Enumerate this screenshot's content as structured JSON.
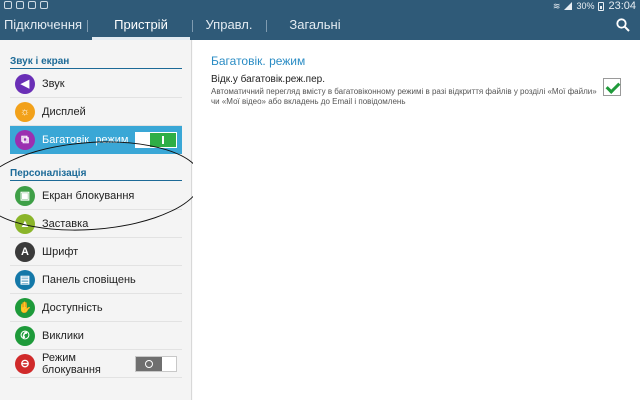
{
  "status_bar": {
    "battery": "30%",
    "time": "23:04"
  },
  "tabs": [
    {
      "label": "Підключення",
      "active": false
    },
    {
      "label": "Пристрій",
      "active": true
    },
    {
      "label": "Управл.",
      "active": false
    },
    {
      "label": "Загальні",
      "active": false
    }
  ],
  "sidebar": {
    "section1": "Звук і екран",
    "section2": "Персоналізація",
    "items": [
      {
        "label": "Звук",
        "icon": "speaker-icon",
        "color": "#6a2fb6"
      },
      {
        "label": "Дисплей",
        "icon": "sun-icon",
        "color": "#f2a11a"
      },
      {
        "label": "Багатовік. режим",
        "icon": "multi-window-icon",
        "color": "#9b2fb0",
        "selected": true,
        "toggle": "on"
      },
      {
        "label": "Екран блокування",
        "icon": "lockscreen-icon",
        "color": "#3e9f47"
      },
      {
        "label": "Заставка",
        "icon": "wallpaper-icon",
        "color": "#8bb52a"
      },
      {
        "label": "Шрифт",
        "icon": "font-icon",
        "color": "#3a3a3a"
      },
      {
        "label": "Панель сповіщень",
        "icon": "notification-panel-icon",
        "color": "#1478a8"
      },
      {
        "label": "Доступність",
        "icon": "hand-icon",
        "color": "#1e9a3a"
      },
      {
        "label": "Виклики",
        "icon": "phone-icon",
        "color": "#1e9a3a"
      },
      {
        "label": "Режим блокування",
        "icon": "blocking-mode-icon",
        "color": "#d02a2a",
        "toggle": "off"
      }
    ]
  },
  "detail": {
    "title": "Багатовік. режим",
    "option_title": "Відк.у багатовік.реж.пер.",
    "option_desc": "Автоматичний перегляд вмісту в багатовіконному режимі в разі відкриття файлів у розділі «Мої файли» чи «Мої відео» або вкладень до Email і повідомлень",
    "checked": true
  },
  "colors": {
    "header": "#2f5a78",
    "accent": "#3aa7d6",
    "section_text": "#1c6a97",
    "switch_on": "#2fae46"
  }
}
